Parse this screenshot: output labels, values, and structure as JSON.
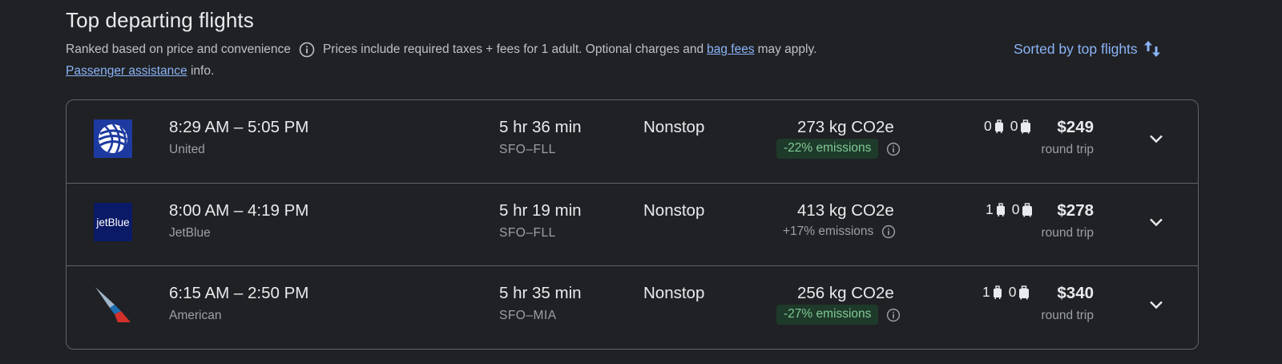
{
  "header": {
    "title": "Top departing flights",
    "ranked_text": "Ranked based on price and convenience",
    "prices_text": "Prices include required taxes + fees for 1 adult. Optional charges and",
    "bag_fees_link": "bag fees",
    "may_apply": "may apply.",
    "passenger_assistance_link": "Passenger assistance",
    "info_suffix": "info.",
    "sort_label": "Sorted by top flights",
    "accent_color": "#8ab4f8"
  },
  "flights": [
    {
      "airline": "United",
      "logo": "united-globe-logo",
      "times": "8:29 AM – 5:05 PM",
      "duration": "5 hr 36 min",
      "route": "SFO–FLL",
      "stops": "Nonstop",
      "co2": "273 kg CO2e",
      "emissions": "-22% emissions",
      "emissions_style": "low",
      "carry_on": "0",
      "checked": "0",
      "price": "$249",
      "trip_type": "round trip"
    },
    {
      "airline": "JetBlue",
      "logo": "jetblue-logo",
      "logo_text": "jetBlue",
      "times": "8:00 AM – 4:19 PM",
      "duration": "5 hr 19 min",
      "route": "SFO–FLL",
      "stops": "Nonstop",
      "co2": "413 kg CO2e",
      "emissions": "+17% emissions",
      "emissions_style": "typical",
      "carry_on": "1",
      "checked": "0",
      "price": "$278",
      "trip_type": "round trip"
    },
    {
      "airline": "American",
      "logo": "american-airlines-logo",
      "times": "6:15 AM – 2:50 PM",
      "duration": "5 hr 35 min",
      "route": "SFO–MIA",
      "stops": "Nonstop",
      "co2": "256 kg CO2e",
      "emissions": "-27% emissions",
      "emissions_style": "low",
      "carry_on": "1",
      "checked": "0",
      "price": "$340",
      "trip_type": "round trip"
    }
  ]
}
